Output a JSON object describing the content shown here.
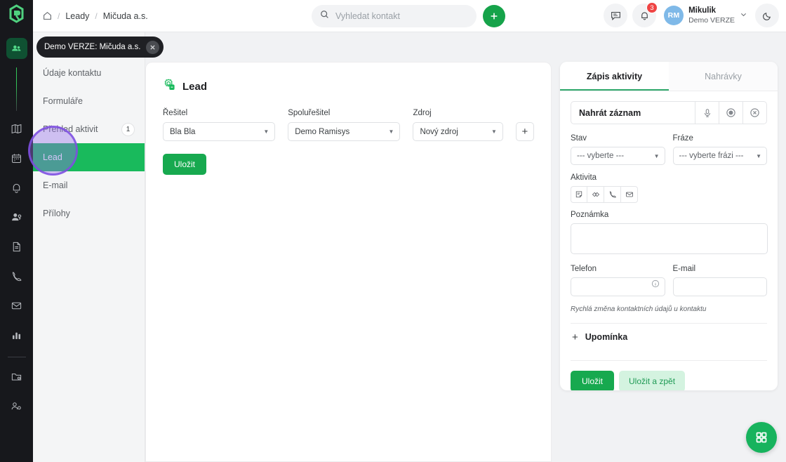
{
  "header": {
    "breadcrumb": [
      "Leady",
      "Mičuda a.s."
    ],
    "home_icon": "home-icon",
    "search": {
      "placeholder": "Vyhledat kontakt",
      "value": "",
      "icon": "search-icon"
    },
    "add_button_label": "+",
    "chat_icon": "chat-icon",
    "bell_icon": "bell-icon",
    "bell_badge": "3",
    "user": {
      "initials": "RM",
      "name": "Mikulik",
      "subtitle": "Demo VERZE",
      "chevron": "chevron-down-icon"
    },
    "theme_icon": "moon-icon"
  },
  "rail": {
    "items": [
      {
        "name": "contacts-icon",
        "active": true
      },
      {
        "name": "book-icon",
        "active": false
      },
      {
        "name": "calendar-icon",
        "active": false
      },
      {
        "name": "bell-icon",
        "active": false
      },
      {
        "name": "user-key-icon",
        "active": false
      },
      {
        "name": "document-icon",
        "active": false
      },
      {
        "name": "phone-icon",
        "active": false
      },
      {
        "name": "mail-icon",
        "active": false
      },
      {
        "name": "chart-icon",
        "active": false
      },
      {
        "name": "folder-settings-icon",
        "active": false
      },
      {
        "name": "user-settings-icon",
        "active": false
      }
    ]
  },
  "toast": {
    "text": "Demo VERZE: Mičuda a.s.",
    "close_icon": "close-icon"
  },
  "subnav": {
    "items": [
      {
        "label": "Údaje kontaktu",
        "badge": "",
        "active": false
      },
      {
        "label": "Formuláře",
        "badge": "",
        "active": false
      },
      {
        "label": "Přehled aktivit",
        "badge": "1",
        "active": false
      },
      {
        "label": "Lead",
        "badge": "",
        "active": true
      },
      {
        "label": "E-mail",
        "badge": "",
        "active": false
      },
      {
        "label": "Přílohy",
        "badge": "",
        "active": false
      }
    ]
  },
  "lead_card": {
    "icon": "lead-gear-icon",
    "title": "Lead",
    "fields": [
      {
        "label": "Řešitel",
        "value": "Bla Bla"
      },
      {
        "label": "Spoluřešitel",
        "value": "Demo Ramisys"
      },
      {
        "label": "Zdroj",
        "value": "Nový zdroj"
      }
    ],
    "add_source_label": "+",
    "save_label": "Uložit"
  },
  "right_panel": {
    "tabs": [
      {
        "label": "Zápis aktivity",
        "active": true
      },
      {
        "label": "Nahrávky",
        "active": false
      }
    ],
    "record": {
      "label": "Nahrát záznam",
      "mic_icon": "microphone-icon",
      "stop_icon": "stop-record-icon",
      "cancel_icon": "cancel-circle-icon"
    },
    "state": {
      "label": "Stav",
      "value": "--- vyberte ---"
    },
    "phrase": {
      "label": "Fráze",
      "value": "--- vyberte frázi ---"
    },
    "activity": {
      "label": "Aktivita",
      "icons": [
        "note-icon",
        "handshake-icon",
        "phone-icon",
        "mail-icon"
      ]
    },
    "note": {
      "label": "Poznámka",
      "value": ""
    },
    "phone": {
      "label": "Telefon",
      "value": "",
      "info_icon": "info-icon"
    },
    "email": {
      "label": "E-mail",
      "value": ""
    },
    "hint": "Rychlá změna kontaktních údajů u kontaktu",
    "reminder": {
      "plus": "+",
      "label": "Upomínka"
    },
    "save_label": "Uložit",
    "save_back_label": "Uložit a zpět"
  },
  "fab": {
    "icon": "grid-apps-icon"
  },
  "colors": {
    "accent_green": "#17a94f",
    "active_nav_green": "#19ba5c",
    "badge_red": "#ef4444",
    "rail_dark": "#17181c",
    "cursor_purple": "#7c4de1"
  }
}
